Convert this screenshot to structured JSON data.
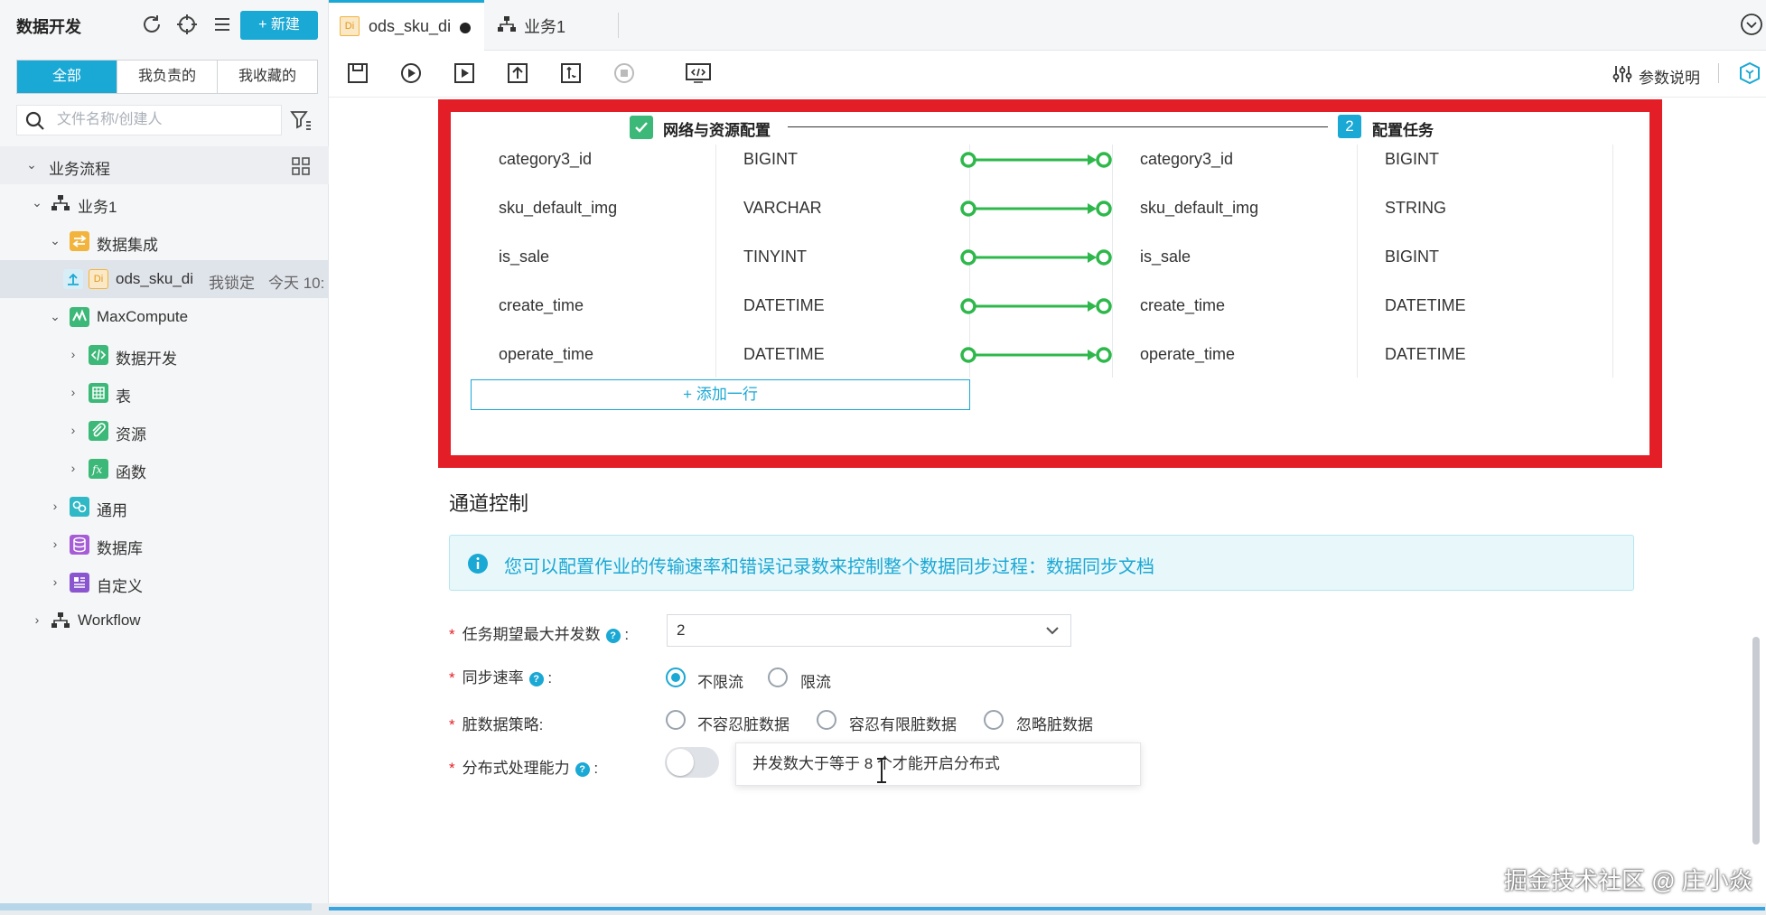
{
  "sidebar": {
    "title": "数据开发",
    "new_button": "+ 新建",
    "filter_tabs": [
      "全部",
      "我负责的",
      "我收藏的"
    ],
    "search_placeholder": "文件名称/创建人",
    "tree": {
      "section": "业务流程",
      "business": "业务1",
      "integration": "数据集成",
      "node_name": "ods_sku_di",
      "node_lock": "我锁定",
      "node_time": "今天 10:",
      "maxcompute": "MaxCompute",
      "dev": "数据开发",
      "table": "表",
      "resource": "资源",
      "function": "函数",
      "common": "通用",
      "database": "数据库",
      "custom": "自定义",
      "workflow": "Workflow"
    }
  },
  "tabs": {
    "file_tab": "ods_sku_di",
    "business_tab": "业务1",
    "di_badge": "Di"
  },
  "toolbar": {
    "params": "参数说明"
  },
  "steps": {
    "step1": "网络与资源配置",
    "step2_num": "2",
    "step2": "配置任务"
  },
  "mapping_rows": [
    {
      "src_name": "category3_id",
      "src_type": "BIGINT",
      "dst_name": "category3_id",
      "dst_type": "BIGINT"
    },
    {
      "src_name": "sku_default_img",
      "src_type": "VARCHAR",
      "dst_name": "sku_default_img",
      "dst_type": "STRING"
    },
    {
      "src_name": "is_sale",
      "src_type": "TINYINT",
      "dst_name": "is_sale",
      "dst_type": "BIGINT"
    },
    {
      "src_name": "create_time",
      "src_type": "DATETIME",
      "dst_name": "create_time",
      "dst_type": "DATETIME"
    },
    {
      "src_name": "operate_time",
      "src_type": "DATETIME",
      "dst_name": "operate_time",
      "dst_type": "DATETIME"
    }
  ],
  "add_row": "+ 添加一行",
  "channel": {
    "title": "通道控制",
    "info": "您可以配置作业的传输速率和错误记录数来控制整个数据同步过程：数据同步文档",
    "concurrency_label": "任务期望最大并发数",
    "concurrency_value": "2",
    "rate_label": "同步速率",
    "rate_options": [
      "不限流",
      "限流"
    ],
    "dirty_label": "脏数据策略:",
    "dirty_options": [
      "不容忍脏数据",
      "容忍有限脏数据",
      "忽略脏数据"
    ],
    "distributed_label": "分布式处理能力",
    "tooltip": "并发数大于等于 8 个才能开启分布式"
  },
  "watermark": "掘金技术社区 @ 庄小焱",
  "colors": {
    "accent": "#1aa8d4",
    "highlight": "#e41e26",
    "mapping_line": "#2eb84b"
  }
}
